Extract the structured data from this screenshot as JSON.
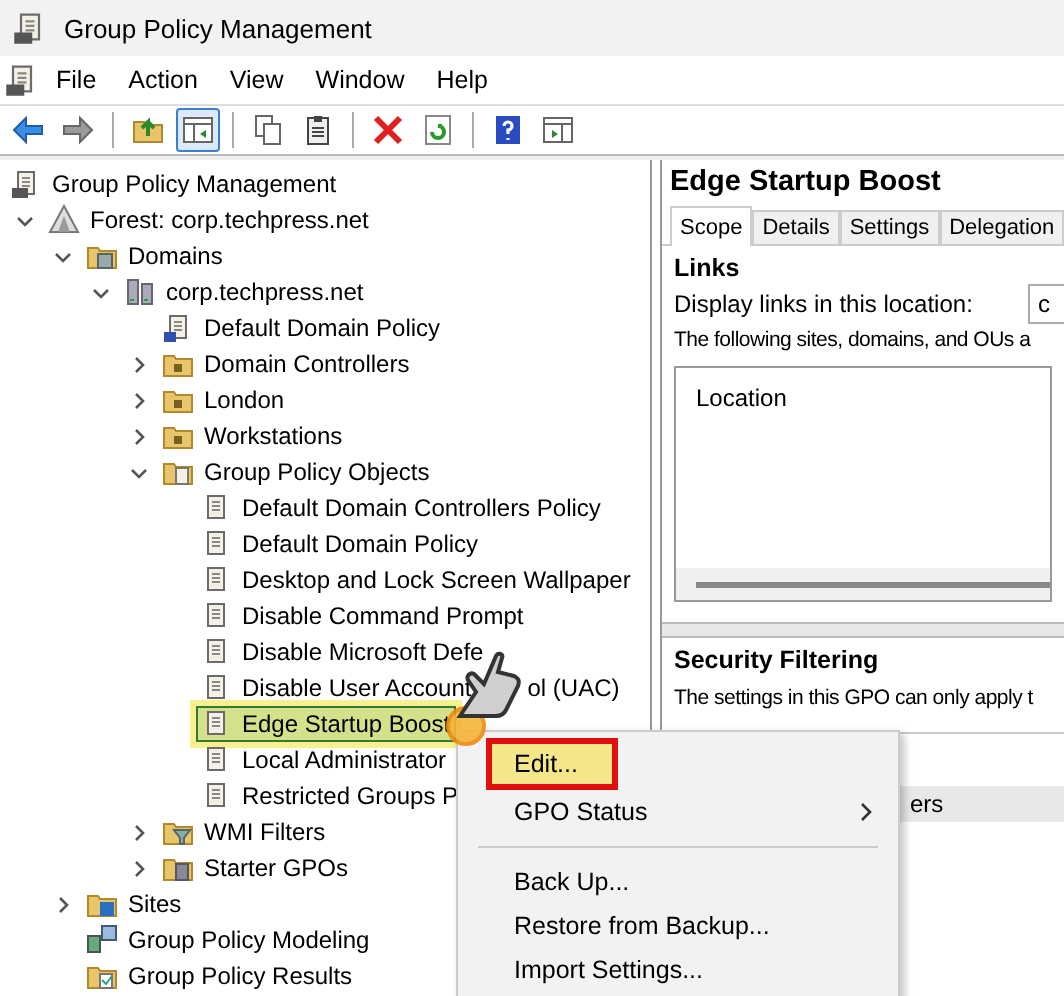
{
  "window": {
    "title": "Group Policy Management"
  },
  "menu_bar": [
    "File",
    "Action",
    "View",
    "Window",
    "Help"
  ],
  "toolbar": [
    {
      "kind": "back",
      "pressed": false
    },
    {
      "kind": "forward",
      "pressed": false
    },
    {
      "kind": "separator"
    },
    {
      "kind": "up",
      "pressed": false
    },
    {
      "kind": "console-tree",
      "pressed": true
    },
    {
      "kind": "separator"
    },
    {
      "kind": "copy",
      "pressed": false
    },
    {
      "kind": "paste",
      "pressed": false
    },
    {
      "kind": "separator"
    },
    {
      "kind": "delete",
      "pressed": false
    },
    {
      "kind": "refresh",
      "pressed": false
    },
    {
      "kind": "separator"
    },
    {
      "kind": "help",
      "pressed": false
    },
    {
      "kind": "action-pane",
      "pressed": false
    }
  ],
  "tree": [
    {
      "label": "Group Policy Management",
      "kind": "console",
      "selected": false,
      "children": [
        {
          "label": "Forest: corp.techpress.net",
          "kind": "forest",
          "selected": false,
          "expanded": true,
          "children": [
            {
              "label": "Domains",
              "kind": "domains",
              "selected": false,
              "expanded": true,
              "children": [
                {
                  "label": "corp.techpress.net",
                  "kind": "domain",
                  "selected": false,
                  "expanded": true,
                  "children": [
                    {
                      "label": "Default Domain Policy",
                      "kind": "gpo-link",
                      "selected": false
                    },
                    {
                      "label": "Domain Controllers",
                      "kind": "ou",
                      "selected": false,
                      "expanded": false
                    },
                    {
                      "label": "London",
                      "kind": "ou",
                      "selected": false,
                      "expanded": false
                    },
                    {
                      "label": "Workstations",
                      "kind": "ou",
                      "selected": false,
                      "expanded": false
                    },
                    {
                      "label": "Group Policy Objects",
                      "kind": "gpo-folder",
                      "selected": false,
                      "expanded": true,
                      "children": [
                        {
                          "label": "Default Domain Controllers Policy",
                          "kind": "gpo",
                          "selected": false
                        },
                        {
                          "label": "Default Domain Policy",
                          "kind": "gpo",
                          "selected": false
                        },
                        {
                          "label": "Desktop and Lock Screen Wallpaper",
                          "kind": "gpo",
                          "selected": false
                        },
                        {
                          "label": "Disable Command Prompt",
                          "kind": "gpo",
                          "selected": false
                        },
                        {
                          "label": "Disable Microsoft Defe",
                          "kind": "gpo",
                          "selected": false
                        },
                        {
                          "label": "Disable User Account",
                          "label_after_cursor": "ol (UAC)",
                          "kind": "gpo",
                          "selected": false
                        },
                        {
                          "label": "Edge Startup Boost",
                          "kind": "gpo",
                          "selected": true
                        },
                        {
                          "label": "Local Administrator",
                          "kind": "gpo",
                          "selected": false
                        },
                        {
                          "label": "Restricted Groups P",
                          "kind": "gpo",
                          "selected": false
                        }
                      ]
                    },
                    {
                      "label": "WMI Filters",
                      "kind": "wmi",
                      "selected": false,
                      "expanded": false
                    },
                    {
                      "label": "Starter GPOs",
                      "kind": "starter",
                      "selected": false,
                      "expanded": false
                    }
                  ]
                }
              ]
            },
            {
              "label": "Sites",
              "kind": "sites",
              "selected": false,
              "expanded": false
            },
            {
              "label": "Group Policy Modeling",
              "kind": "modeling",
              "selected": false
            },
            {
              "label": "Group Policy Results",
              "kind": "results",
              "selected": false
            }
          ]
        }
      ]
    }
  ],
  "details": {
    "title": "Edge Startup Boost",
    "tabs": [
      {
        "label": "Scope",
        "selected": true
      },
      {
        "label": "Details",
        "selected": false
      },
      {
        "label": "Settings",
        "selected": false
      },
      {
        "label": "Delegation",
        "selected": false
      }
    ],
    "links": {
      "heading": "Links",
      "display_label": "Display links in this location:",
      "display_value": "c",
      "description": "The following sites, domains, and OUs a",
      "columns": [
        "Location"
      ]
    },
    "security_filtering": {
      "heading": "Security Filtering",
      "description": "The settings in this GPO can only apply t",
      "rows": [
        "ers"
      ]
    }
  },
  "context_menu": {
    "groups": [
      [
        {
          "label": "Edit...",
          "selected": true,
          "submenu": false
        },
        {
          "label": "GPO Status",
          "selected": false,
          "submenu": true
        }
      ],
      [
        {
          "label": "Back Up...",
          "selected": false,
          "submenu": false
        },
        {
          "label": "Restore from Backup...",
          "selected": false,
          "submenu": false
        },
        {
          "label": "Import Settings...",
          "selected": false,
          "submenu": false
        }
      ]
    ]
  }
}
